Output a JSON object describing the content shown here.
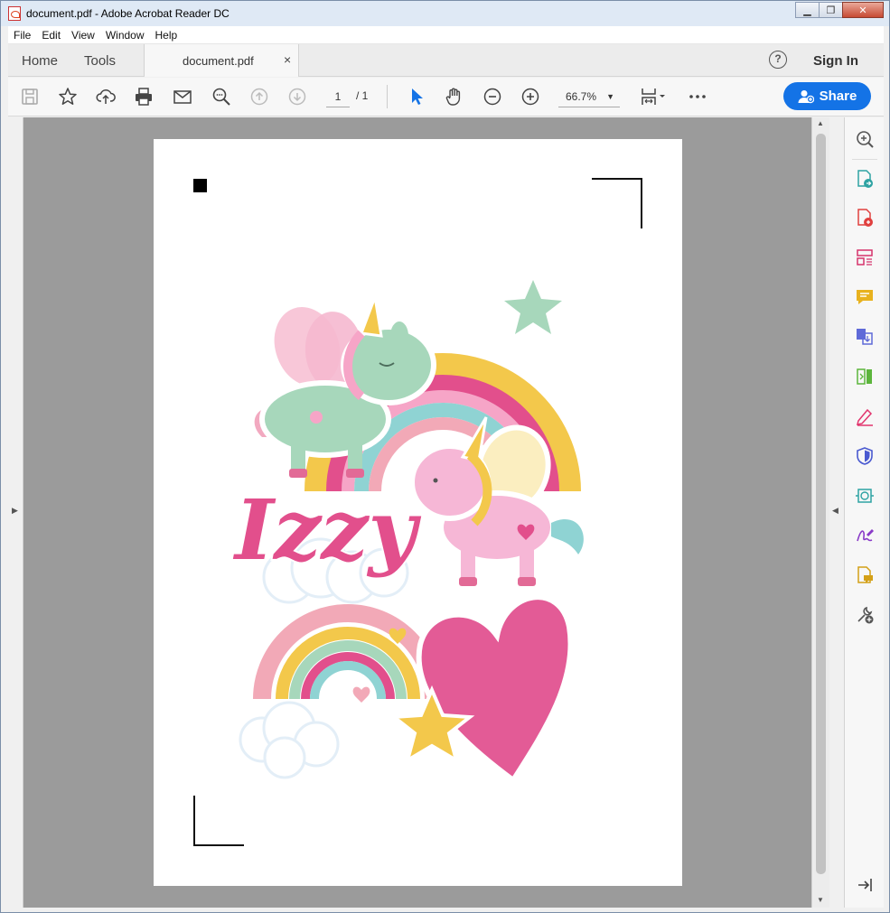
{
  "window": {
    "title": "document.pdf - Adobe Acrobat Reader DC"
  },
  "menu": [
    "File",
    "Edit",
    "View",
    "Window",
    "Help"
  ],
  "tabs": {
    "home": "Home",
    "tools": "Tools",
    "document": "document.pdf",
    "close": "×"
  },
  "header": {
    "sign_in": "Sign In"
  },
  "toolbar": {
    "page_current": "1",
    "page_separator": "/ 1",
    "zoom": "66.7%",
    "share": "Share"
  },
  "document": {
    "title_art": "Izzy"
  },
  "colors": {
    "accent": "#1473e6",
    "pink": "#e24f8c",
    "mint": "#a7d7bb",
    "yellow": "#f3c84b",
    "teal": "#8fd3d3"
  },
  "right_panel_icons": [
    "zoom-search-icon",
    "export-pdf-icon",
    "create-pdf-icon",
    "organize-pages-icon",
    "comment-icon",
    "combine-files-icon",
    "compress-icon",
    "fill-sign-icon",
    "protect-icon",
    "send-for-review-icon",
    "sign-icon",
    "send-comments-icon",
    "more-tools-icon",
    "collapse-panel-icon"
  ]
}
